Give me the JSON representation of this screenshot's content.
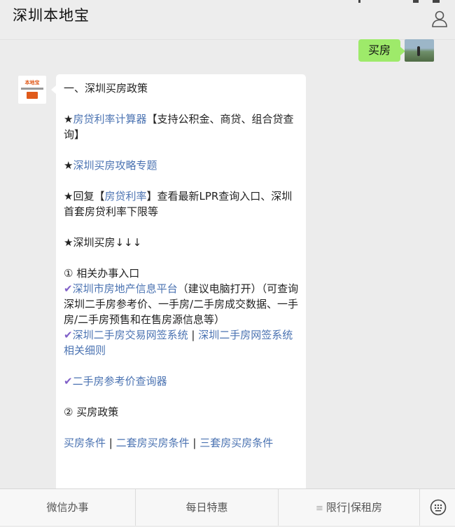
{
  "header": {
    "title": "深圳本地宝"
  },
  "chat": {
    "my_message": "买房",
    "bot_message": {
      "line1": "一、深圳买房政策",
      "item1_star": "★",
      "item1_link": "房贷利率计算器",
      "item1_text": "【支持公积金、商贷、组合贷查询】",
      "item2_star": "★",
      "item2_link": "深圳买房攻略专题",
      "item3_pre": "★回复【",
      "item3_link": "房贷利率",
      "item3_post": "】查看最新LPR查询入口、深圳首套房贷利率下限等",
      "item4": "★深圳买房↓↓↓",
      "sec1_title": "① 相关办事入口",
      "check": "✔",
      "sec1_link1": "深圳市房地产信息平台",
      "sec1_text1": "（建议电脑打开）（可查询深圳二手房参考价、一手房/二手房成交数据、一手房/二手房预售和在售房源信息等）",
      "sec1_link2": "深圳二手房交易网签系统",
      "sep": " | ",
      "sec1_link3": "深圳二手房网签系统相关细则",
      "sec1_link4": "二手房参考价查询器",
      "sec2_title": "② 买房政策",
      "sec2_link1": "买房条件",
      "sec2_link2": "二套房买房条件",
      "sec2_link3": "三套房买房条件"
    }
  },
  "bottom_bar": {
    "tab1": "微信办事",
    "tab2": "每日特惠",
    "tab3_icon": "≡",
    "tab3": "限行|保租房"
  },
  "icons": {
    "user": "user-icon",
    "keyboard": "emoji-keyboard-icon"
  },
  "colors": {
    "link": "#4b73b2",
    "my_bubble": "#9eea6a",
    "check": "#8060c8"
  }
}
